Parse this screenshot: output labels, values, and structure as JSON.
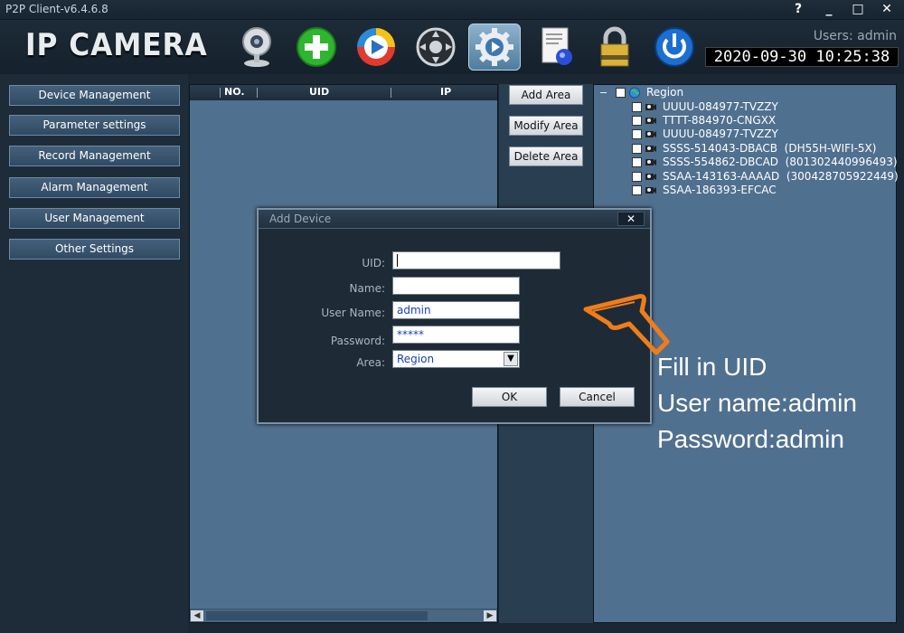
{
  "window": {
    "title": "P2P Client-v6.4.6.8",
    "controls": [
      "?",
      "_",
      "□",
      "✕"
    ]
  },
  "header": {
    "logo": "IP CAMERA",
    "users_label": "Users: admin",
    "datetime": "2020-09-30 10:25:38",
    "toolbar_icons": [
      "webcam-icon",
      "add-icon",
      "playback-icon",
      "ptz-icon",
      "settings-icon",
      "log-icon",
      "lock-icon",
      "power-icon"
    ]
  },
  "sidebar": {
    "items": [
      {
        "label": "Device Management"
      },
      {
        "label": "Parameter settings"
      },
      {
        "label": "Record Management"
      },
      {
        "label": "Alarm Management"
      },
      {
        "label": "User Management"
      },
      {
        "label": "Other Settings"
      }
    ]
  },
  "device_table": {
    "columns": [
      "NO.",
      "UID",
      "IP"
    ]
  },
  "area_buttons": {
    "add": "Add Area",
    "modify": "Modify Area",
    "delete": "Delete Area"
  },
  "tree": {
    "root": "Region",
    "devices": [
      "UUUU-084977-TVZZY",
      "TTTT-884970-CNGXX",
      "UUUU-084977-TVZZY",
      "SSSS-514043-DBACB  (DH55H-WIFI-5X)",
      "SSSS-554862-DBCAD  (801302440996493)",
      "SSAA-143163-AAAAD  (300428705922449)",
      "SSAA-186393-EFCAC"
    ]
  },
  "dialog": {
    "title": "Add Device",
    "close": "✕",
    "uid_label": "UID:",
    "uid_value": "",
    "name_label": "Name:",
    "name_value": "",
    "username_label": "User Name:",
    "username_value": "admin",
    "password_label": "Password:",
    "password_value": "*****",
    "area_label": "Area:",
    "area_value": "Region",
    "ok": "OK",
    "cancel": "Cancel"
  },
  "annotation": {
    "line1": "Fill in UID",
    "line2": "User name:admin",
    "line3": "Password:admin",
    "arrow_color": "#f07d1a"
  },
  "colors": {
    "panel": "#50708f",
    "background": "#1b2733",
    "accent_orange": "#f07d1a"
  }
}
